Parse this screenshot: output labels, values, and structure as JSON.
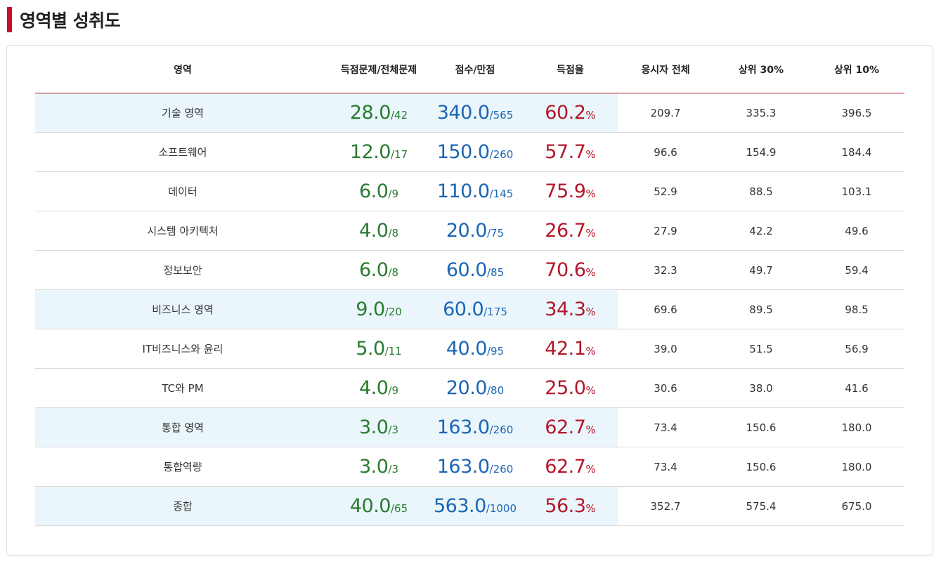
{
  "title": "영역별 성취도",
  "columns": [
    "영역",
    "득점문제/전체문제",
    "점수/만점",
    "득점율",
    "응시자 전체",
    "상위 30%",
    "상위 10%"
  ],
  "rows": [
    {
      "name": "기술 영역",
      "q": "28.0",
      "qt": "/42",
      "s": "340.0",
      "st": "/565",
      "r": "60.2",
      "rp": "%",
      "all": "209.7",
      "top30": "335.3",
      "top10": "396.5",
      "highlight": true
    },
    {
      "name": "소프트웨어",
      "q": "12.0",
      "qt": "/17",
      "s": "150.0",
      "st": "/260",
      "r": "57.7",
      "rp": "%",
      "all": "96.6",
      "top30": "154.9",
      "top10": "184.4",
      "highlight": false
    },
    {
      "name": "데이터",
      "q": "6.0",
      "qt": "/9",
      "s": "110.0",
      "st": "/145",
      "r": "75.9",
      "rp": "%",
      "all": "52.9",
      "top30": "88.5",
      "top10": "103.1",
      "highlight": false
    },
    {
      "name": "시스템 아키텍처",
      "q": "4.0",
      "qt": "/8",
      "s": "20.0",
      "st": "/75",
      "r": "26.7",
      "rp": "%",
      "all": "27.9",
      "top30": "42.2",
      "top10": "49.6",
      "highlight": false
    },
    {
      "name": "정보보안",
      "q": "6.0",
      "qt": "/8",
      "s": "60.0",
      "st": "/85",
      "r": "70.6",
      "rp": "%",
      "all": "32.3",
      "top30": "49.7",
      "top10": "59.4",
      "highlight": false
    },
    {
      "name": "비즈니스 영역",
      "q": "9.0",
      "qt": "/20",
      "s": "60.0",
      "st": "/175",
      "r": "34.3",
      "rp": "%",
      "all": "69.6",
      "top30": "89.5",
      "top10": "98.5",
      "highlight": true
    },
    {
      "name": "IT비즈니스와 윤리",
      "q": "5.0",
      "qt": "/11",
      "s": "40.0",
      "st": "/95",
      "r": "42.1",
      "rp": "%",
      "all": "39.0",
      "top30": "51.5",
      "top10": "56.9",
      "highlight": false
    },
    {
      "name": "TC와 PM",
      "q": "4.0",
      "qt": "/9",
      "s": "20.0",
      "st": "/80",
      "r": "25.0",
      "rp": "%",
      "all": "30.6",
      "top30": "38.0",
      "top10": "41.6",
      "highlight": false
    },
    {
      "name": "통합 영역",
      "q": "3.0",
      "qt": "/3",
      "s": "163.0",
      "st": "/260",
      "r": "62.7",
      "rp": "%",
      "all": "73.4",
      "top30": "150.6",
      "top10": "180.0",
      "highlight": true
    },
    {
      "name": "통합역량",
      "q": "3.0",
      "qt": "/3",
      "s": "163.0",
      "st": "/260",
      "r": "62.7",
      "rp": "%",
      "all": "73.4",
      "top30": "150.6",
      "top10": "180.0",
      "highlight": false
    },
    {
      "name": "종합",
      "q": "40.0",
      "qt": "/65",
      "s": "563.0",
      "st": "/1000",
      "r": "56.3",
      "rp": "%",
      "all": "352.7",
      "top30": "575.4",
      "top10": "675.0",
      "highlight": true
    }
  ],
  "colors": {
    "accent": "#c8102e",
    "green": "#2a7a30",
    "blue": "#1b65b5",
    "red": "#b3172a",
    "highlight_bg": "#eaf6fb"
  }
}
